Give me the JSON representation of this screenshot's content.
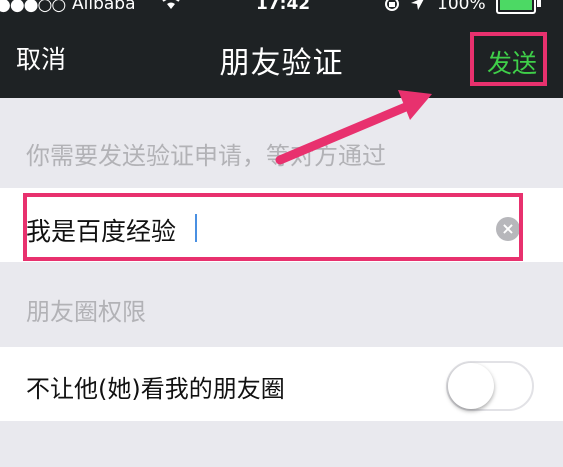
{
  "status_bar": {
    "signal": "●●●○○",
    "carrier": "Alibaba",
    "wifi_icon": "wifi-icon",
    "time": "17:42",
    "battery": "100%",
    "battery_level": 1.0,
    "battery_color": "#4cd964"
  },
  "nav": {
    "cancel_label": "取消",
    "title": "朋友验证",
    "send_label": "发送",
    "send_color": "#3fcf49",
    "background": "#1e2224"
  },
  "form": {
    "hint": "你需要发送验证申请，等对方通过",
    "message_value": "我是百度经验",
    "section_label": "朋友圈权限",
    "privacy_label": "不让他(她)看我的朋友圈",
    "privacy_enabled": false
  },
  "annotations": {
    "highlight_color": "#e8316e"
  }
}
